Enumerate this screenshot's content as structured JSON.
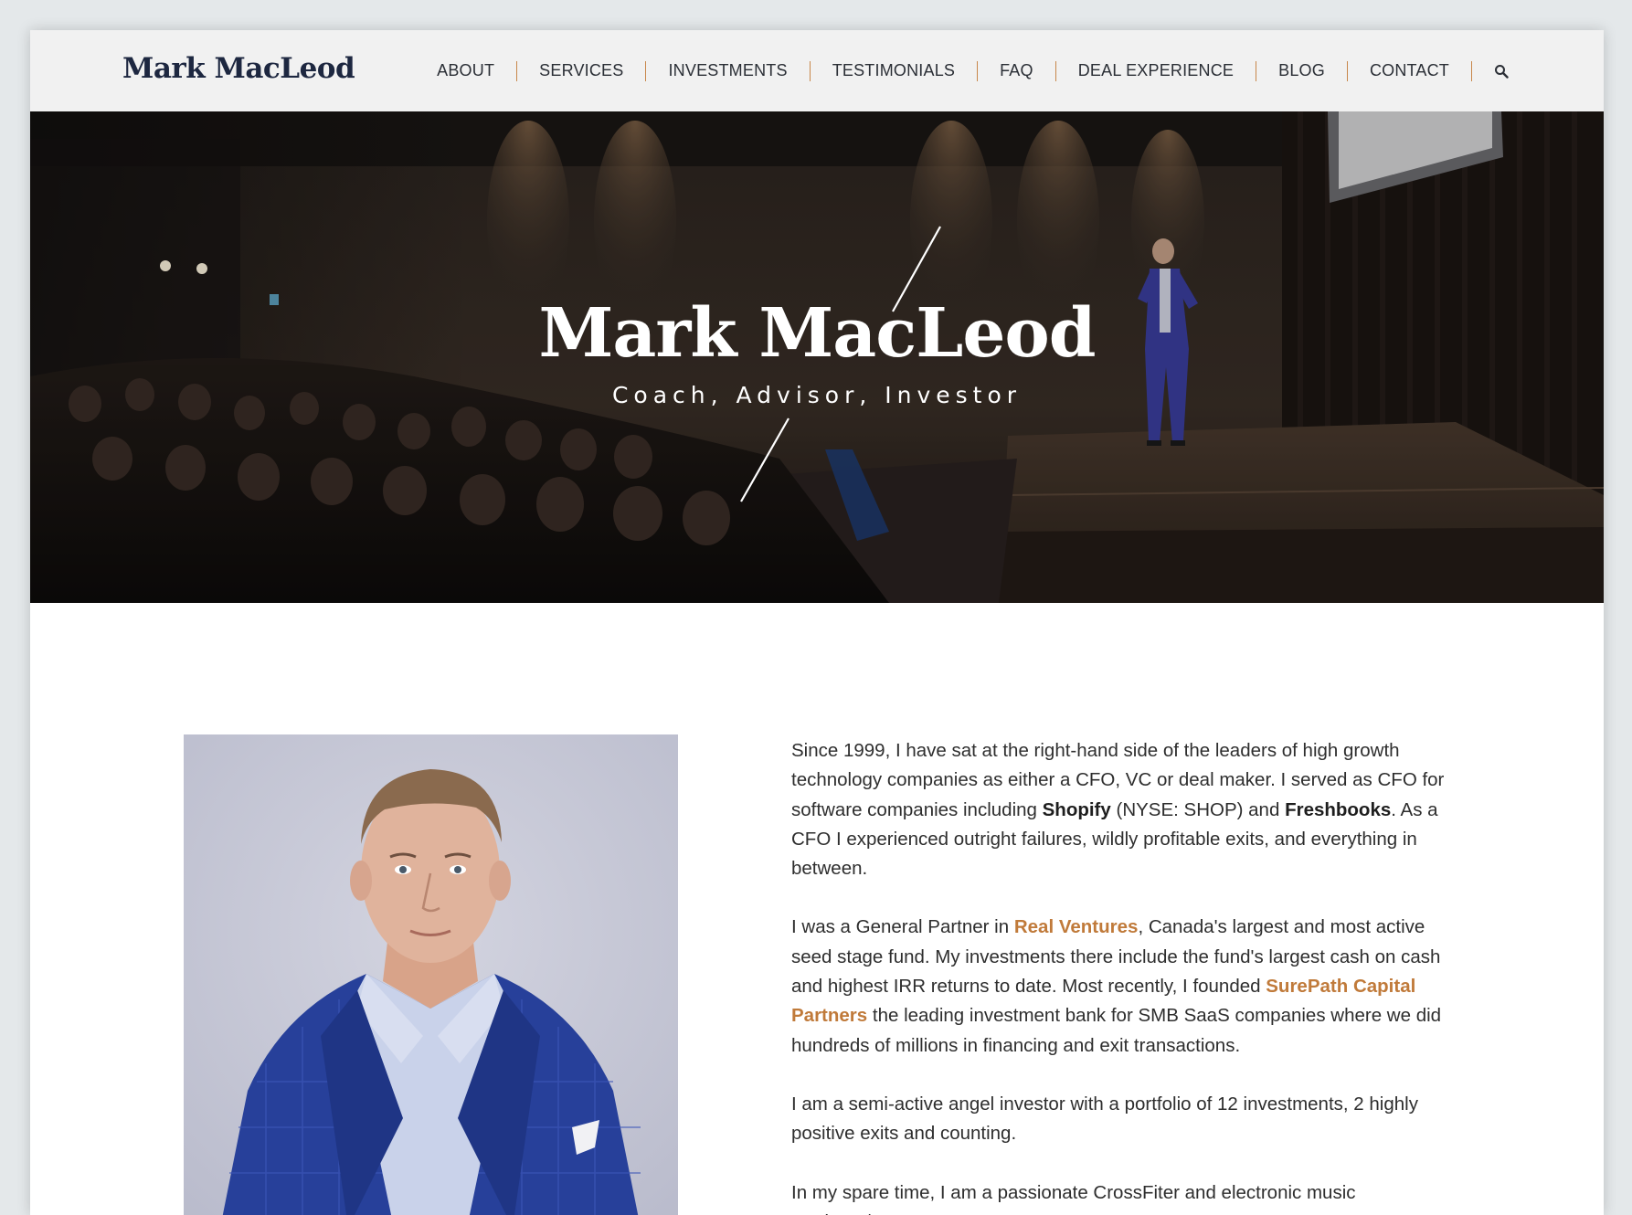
{
  "header": {
    "logo": "Mark MacLeod",
    "nav": [
      {
        "label": "ABOUT"
      },
      {
        "label": "SERVICES"
      },
      {
        "label": "INVESTMENTS"
      },
      {
        "label": "TESTIMONIALS"
      },
      {
        "label": "FAQ"
      },
      {
        "label": "DEAL EXPERIENCE"
      },
      {
        "label": "BLOG"
      },
      {
        "label": "CONTACT"
      }
    ],
    "search_icon": "search-icon"
  },
  "hero": {
    "title": "Mark MacLeod",
    "subtitle": "Coach, Advisor, Investor"
  },
  "bio": {
    "p1": {
      "t1": "Since 1999, I have sat at the right-hand side of the leaders of high growth technology companies as either a CFO, VC or deal maker. I served as CFO for software companies including ",
      "b1": "Shopify",
      "t2": " (NYSE: SHOP) and ",
      "b2": "Freshbooks",
      "t3": ". As a CFO I experienced outright failures, wildly profitable exits, and everything in between."
    },
    "p2": {
      "t1": "I was a General Partner in ",
      "link1": "Real Ventures",
      "t2": ", Canada's largest and most active seed stage fund. My investments there include the fund's largest cash on cash and highest IRR returns to date. Most recently, I founded ",
      "link2": "SurePath Capital Partners",
      "t3": " the leading investment bank for SMB SaaS companies where we did hundreds of millions in financing and exit transactions."
    },
    "p3": "I am a semi-active angel investor with a portfolio of 12 investments, 2 highly positive exits and counting.",
    "p4": "In my spare time, I am a passionate CrossFiter and electronic music producer/DJ."
  },
  "colors": {
    "logo": "#1d2740",
    "accent": "#c07a3a",
    "nav_separator": "#c8874a",
    "header_bg": "#f1f1f1",
    "body_text": "#2e2e2e"
  }
}
